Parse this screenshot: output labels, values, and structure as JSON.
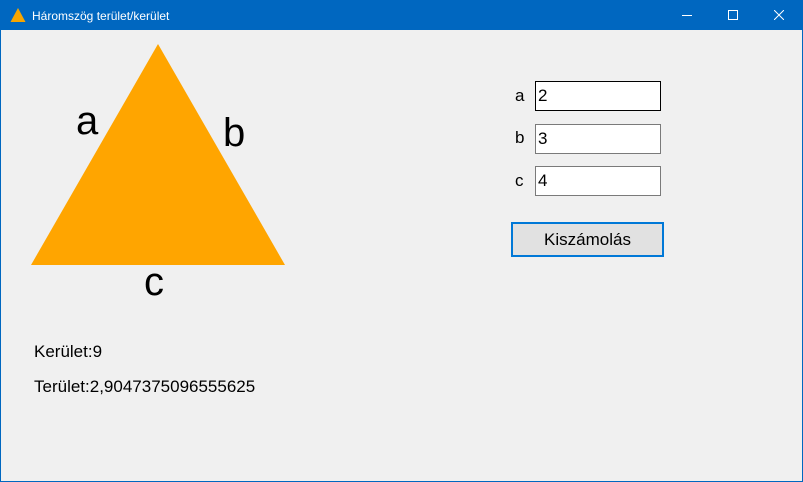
{
  "window": {
    "title": "Háromszög terület/kerület",
    "accent_color": "#0067c0",
    "icon": "warning-triangle-icon",
    "controls": [
      "minimize-icon",
      "maximize-icon",
      "close-icon"
    ]
  },
  "triangle": {
    "color": "#ffa500",
    "labels": {
      "a": "a",
      "b": "b",
      "c": "c"
    }
  },
  "form": {
    "a": {
      "label": "a",
      "value": "2"
    },
    "b": {
      "label": "b",
      "value": "3"
    },
    "c": {
      "label": "c",
      "value": "4"
    },
    "calculate_label": "Kiszámolás"
  },
  "results": {
    "perimeter": "Kerület:9",
    "area": "Terület:2,9047375096555625"
  }
}
